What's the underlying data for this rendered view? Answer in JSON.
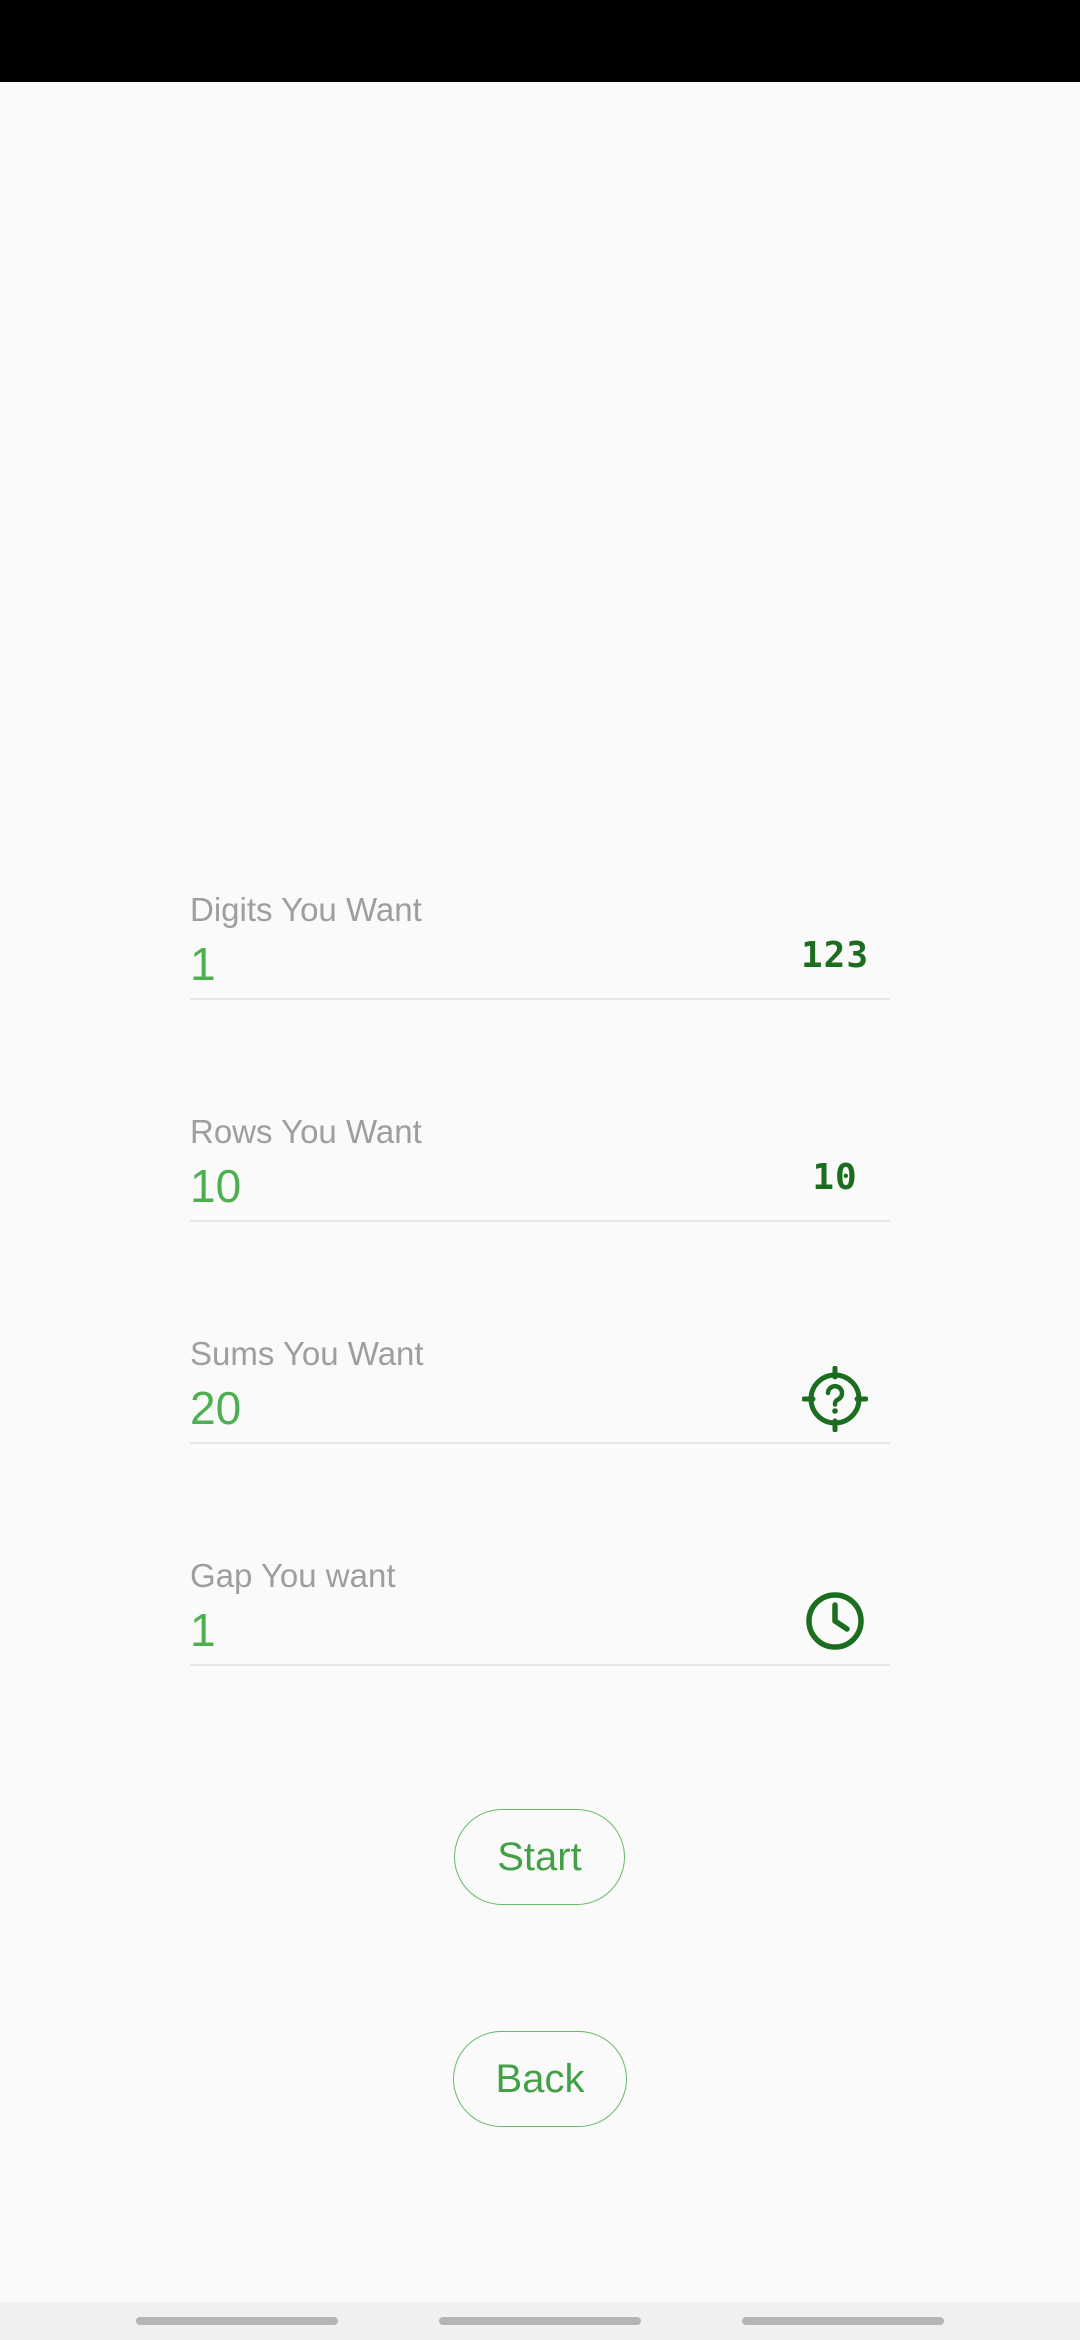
{
  "form": {
    "fields": [
      {
        "label": "Digits You Want",
        "value": "1",
        "icon": "numbers-123-icon",
        "icon_text": "123"
      },
      {
        "label": "Rows You Want",
        "value": "10",
        "icon": "number-10-icon",
        "icon_text": "10"
      },
      {
        "label": "Sums You Want",
        "value": "20",
        "icon": "target-question-icon"
      },
      {
        "label": "Gap You want",
        "value": "1",
        "icon": "clock-icon"
      }
    ]
  },
  "buttons": {
    "start": "Start",
    "back": "Back"
  },
  "colors": {
    "accent": "#4caf50",
    "icon": "#1b6e20",
    "label": "#9e9e9e",
    "background": "#fafafa"
  }
}
